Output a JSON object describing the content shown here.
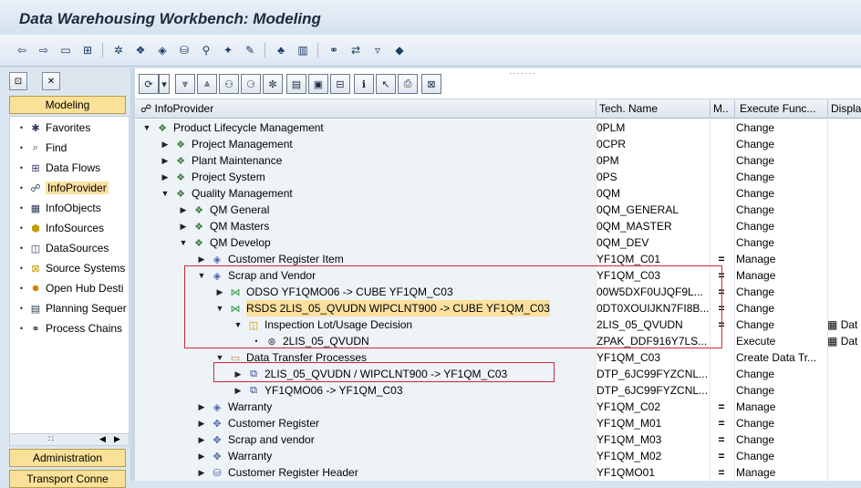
{
  "window": {
    "title": "Data Warehousing Workbench: Modeling"
  },
  "toolbar": {
    "icons": [
      "back-arrow-icon",
      "forward-arrow-icon",
      "view-icon",
      "hierarchy-icon",
      "connect-icon",
      "model-icon",
      "cube-icon",
      "database-icon",
      "search-icon",
      "wizard-icon",
      "tree-icon",
      "columns-icon",
      "link-icon",
      "transport-icon",
      "basket-icon",
      "metadata-icon"
    ]
  },
  "left_panel": {
    "modeling_label": "Modeling",
    "items": [
      {
        "label": "Favorites",
        "icon": "favorites-icon"
      },
      {
        "label": "Find",
        "icon": "find-icon"
      },
      {
        "label": "Data Flows",
        "icon": "data-flows-icon"
      },
      {
        "label": "InfoProvider",
        "icon": "infoprovider-icon",
        "selected": true
      },
      {
        "label": "InfoObjects",
        "icon": "infoobjects-icon"
      },
      {
        "label": "InfoSources",
        "icon": "infosources-icon"
      },
      {
        "label": "DataSources",
        "icon": "datasources-icon"
      },
      {
        "label": "Source Systems",
        "icon": "source-systems-icon"
      },
      {
        "label": "Open Hub Desti",
        "icon": "open-hub-icon"
      },
      {
        "label": "Planning Sequer",
        "icon": "planning-icon"
      },
      {
        "label": "Process Chains",
        "icon": "process-chains-icon"
      }
    ],
    "administration_label": "Administration",
    "transport_label": "Transport Conne"
  },
  "table": {
    "headers": {
      "tree": "InfoProvider",
      "tech": "Tech. Name",
      "m": "M..",
      "exec": "Execute Func...",
      "disp": "Displa"
    },
    "rows": [
      {
        "label": "Product Lifecycle Management",
        "tech": "0PLM",
        "m": "",
        "exec": "Change",
        "disp": ""
      },
      {
        "label": "Project Management",
        "tech": "0CPR",
        "m": "",
        "exec": "Change",
        "disp": ""
      },
      {
        "label": "Plant Maintenance",
        "tech": "0PM",
        "m": "",
        "exec": "Change",
        "disp": ""
      },
      {
        "label": "Project System",
        "tech": "0PS",
        "m": "",
        "exec": "Change",
        "disp": ""
      },
      {
        "label": "Quality Management",
        "tech": "0QM",
        "m": "",
        "exec": "Change",
        "disp": ""
      },
      {
        "label": "QM General",
        "tech": "0QM_GENERAL",
        "m": "",
        "exec": "Change",
        "disp": ""
      },
      {
        "label": "QM Masters",
        "tech": "0QM_MASTER",
        "m": "",
        "exec": "Change",
        "disp": ""
      },
      {
        "label": "QM Develop",
        "tech": "0QM_DEV",
        "m": "",
        "exec": "Change",
        "disp": ""
      },
      {
        "label": "Customer Register Item",
        "tech": "YF1QM_C01",
        "m": "=",
        "exec": "Manage",
        "disp": ""
      },
      {
        "label": "Scrap and Vendor",
        "tech": "YF1QM_C03",
        "m": "=",
        "exec": "Manage",
        "disp": ""
      },
      {
        "label": "ODSO YF1QMO06 -> CUBE YF1QM_C03",
        "tech": "00W5DXF0UJQF9L...",
        "m": "=",
        "exec": "Change",
        "disp": ""
      },
      {
        "label": "RSDS 2LIS_05_QVUDN WIPCLNT900 -> CUBE YF1QM_C03",
        "tech": "0DT0XOUIJKN7FI8B...",
        "m": "=",
        "exec": "Change",
        "disp": ""
      },
      {
        "label": "Inspection Lot/Usage Decision",
        "tech": "2LIS_05_QVUDN",
        "m": "=",
        "exec": "Change",
        "disp": "Dat"
      },
      {
        "label": "2LIS_05_QVUDN",
        "tech": "ZPAK_DDF916Y7LS...",
        "m": "",
        "exec": "Execute",
        "disp": "Dat"
      },
      {
        "label": "Data Transfer Processes",
        "tech": "YF1QM_C03",
        "m": "",
        "exec": "Create Data Tr...",
        "disp": ""
      },
      {
        "label": "2LIS_05_QVUDN / WIPCLNT900 -> YF1QM_C03",
        "tech": "DTP_6JC99FYZCNL...",
        "m": "",
        "exec": "Change",
        "disp": ""
      },
      {
        "label": "YF1QMO06 -> YF1QM_C03",
        "tech": "DTP_6JC99FYZCNL...",
        "m": "",
        "exec": "Change",
        "disp": ""
      },
      {
        "label": "Warranty",
        "tech": "YF1QM_C02",
        "m": "=",
        "exec": "Manage",
        "disp": ""
      },
      {
        "label": "Customer Register",
        "tech": "YF1QM_M01",
        "m": "=",
        "exec": "Change",
        "disp": ""
      },
      {
        "label": "Scrap and vendor",
        "tech": "YF1QM_M03",
        "m": "=",
        "exec": "Change",
        "disp": ""
      },
      {
        "label": "Warranty",
        "tech": "YF1QM_M02",
        "m": "=",
        "exec": "Change",
        "disp": ""
      },
      {
        "label": "Customer Register Header",
        "tech": "YF1QMO01",
        "m": "=",
        "exec": "Manage",
        "disp": ""
      }
    ]
  }
}
